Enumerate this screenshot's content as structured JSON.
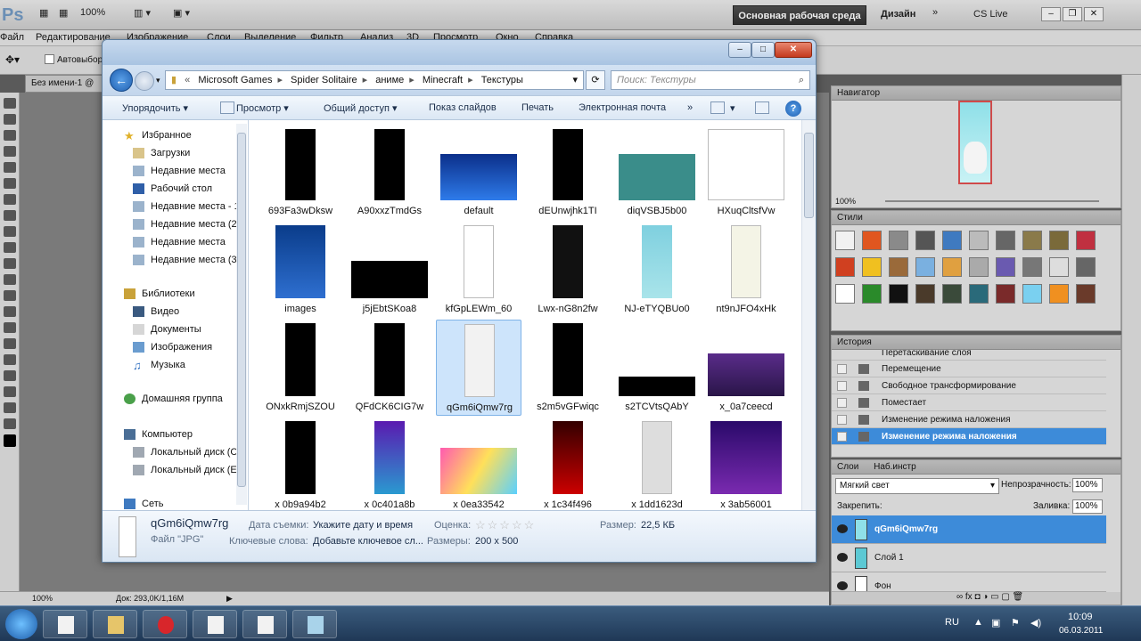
{
  "ps": {
    "logo": "Ps",
    "zoom": "100%",
    "workspace_btn": "Основная рабочая среда",
    "design": "Дизайн",
    "cslive": "CS Live",
    "menu": [
      "Файл",
      "Редактирование",
      "Изображение",
      "Слои",
      "Выделение",
      "Фильтр",
      "Анализ",
      "3D",
      "Просмотр",
      "Окно",
      "Справка"
    ],
    "auto_select": "Автовыбор",
    "doc_tab": "Без имени-1 @",
    "status_zoom": "100%",
    "status_doc": "Док: 293,0K/1,16M"
  },
  "panels": {
    "navigator": "Навигатор",
    "nav_zoom": "100%",
    "styles": "Стили",
    "history": "История",
    "history_items": [
      "Перетаскивание слоя",
      "Перемещение",
      "Свободное трансформирование",
      "Поместает",
      "Изменение режима наложения",
      "Изменение режима наложения"
    ],
    "layers_tab": "Слои",
    "adjust_tab": "Наб.инстр",
    "blend_mode": "Мягкий свет",
    "opacity_label": "Непрозрачность:",
    "opacity_val": "100%",
    "lock_label": "Закрепить:",
    "fill_label": "Заливка:",
    "fill_val": "100%",
    "layers": [
      "qGm6iQmw7rg",
      "Слой 1",
      "Фон"
    ]
  },
  "explorer": {
    "address": [
      "Microsoft Games",
      "Spider Solitaire",
      "аниме",
      "Minecraft",
      "Текстуры"
    ],
    "search_placeholder": "Поиск: Текстуры",
    "commands": [
      "Упорядочить",
      "Просмотр",
      "Общий доступ",
      "Показ слайдов",
      "Печать",
      "Электронная почта",
      "»"
    ],
    "nav": {
      "favorites": "Избранное",
      "fav_items": [
        "Загрузки",
        "Недавние места",
        "Рабочий стол",
        "Недавние места - 1",
        "Недавние места (2",
        "Недавние места",
        "Недавние места (3"
      ],
      "libraries": "Библиотеки",
      "lib_items": [
        "Видео",
        "Документы",
        "Изображения",
        "Музыка"
      ],
      "homegroup": "Домашняя группа",
      "computer": "Компьютер",
      "comp_items": [
        "Локальный диск (С",
        "Локальный диск (Е"
      ],
      "network": "Сеть"
    },
    "files": [
      "693Fa3wDksw",
      "A90xxzTmdGs",
      "default",
      "dEUnwjhk1TI",
      "diqVSBJ5b00",
      "HXuqCltsfVw",
      "images",
      "j5jEbtSKoa8",
      "kfGpLEWm_60",
      "Lwx-nG8n2fw",
      "NJ-eTYQBUo0",
      "nt9nJFO4xHk",
      "ONxkRmjSZOU",
      "QFdCK6CIG7w",
      "qGm6iQmw7rg",
      "s2m5vGFwiqc",
      "s2TCVtsQAbY",
      "x_0a7ceecd",
      "x 0b9a94b2",
      "x 0c401a8b",
      "x 0ea33542",
      "x 1c34f496",
      "x 1dd1623d",
      "x 3ab56001"
    ],
    "details": {
      "name": "qGm6iQmw7rg",
      "type": "Файл \"JPG\"",
      "date_k": "Дата съемки:",
      "date_v": "Укажите дату и время",
      "rating_k": "Оценка:",
      "size_k": "Размер:",
      "size_v": "22,5 КБ",
      "kw_k": "Ключевые слова:",
      "kw_v": "Добавьте ключевое сл...",
      "dim_k": "Размеры:",
      "dim_v": "200 x 500"
    }
  },
  "taskbar": {
    "lang": "RU",
    "time": "10:09",
    "date": "06.03.2011"
  }
}
